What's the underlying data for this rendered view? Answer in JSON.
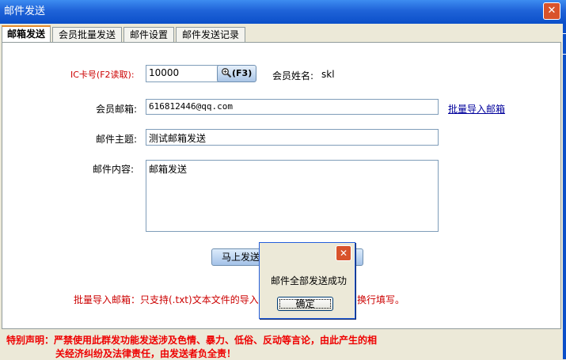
{
  "window": {
    "title": "邮件发送",
    "close": "✕"
  },
  "tabs": [
    {
      "label": "邮箱发送",
      "active": true
    },
    {
      "label": "会员批量发送",
      "active": false
    },
    {
      "label": "邮件设置",
      "active": false
    },
    {
      "label": "邮件发送记录",
      "active": false
    }
  ],
  "form": {
    "ic_label": "IC卡号(F2读取):",
    "ic_value": "10000",
    "search_button": "(F3)",
    "member_name_label": "会员姓名:",
    "member_name_value": "skl",
    "email_label": "会员邮箱:",
    "email_value": "616812446@qq.com",
    "batch_import_link": "批量导入邮箱",
    "subject_label": "邮件主题:",
    "subject_value": "测试邮箱发送",
    "content_label": "邮件内容:",
    "content_value": "邮箱发送",
    "send_button": "马上发送",
    "note_prefix": "批量导入邮箱：只支持(.txt)文本文件的导入",
    "note_suffix": "换行填写。"
  },
  "warning": {
    "line1": "特别声明：严禁使用此群发功能发送涉及色情、暴力、低俗、反动等言论，由此产生的相",
    "line2": "关经济纠纷及法律责任，由发送者负全责！"
  },
  "dialog": {
    "close": "✕",
    "message": "邮件全部发送成功",
    "ok_button": "确定"
  },
  "colors": {
    "titlebar": "#0b4fc9",
    "warning": "#ee0000",
    "note": "#cc0000"
  },
  "icons": {
    "search": "search-icon",
    "close": "close-icon"
  }
}
